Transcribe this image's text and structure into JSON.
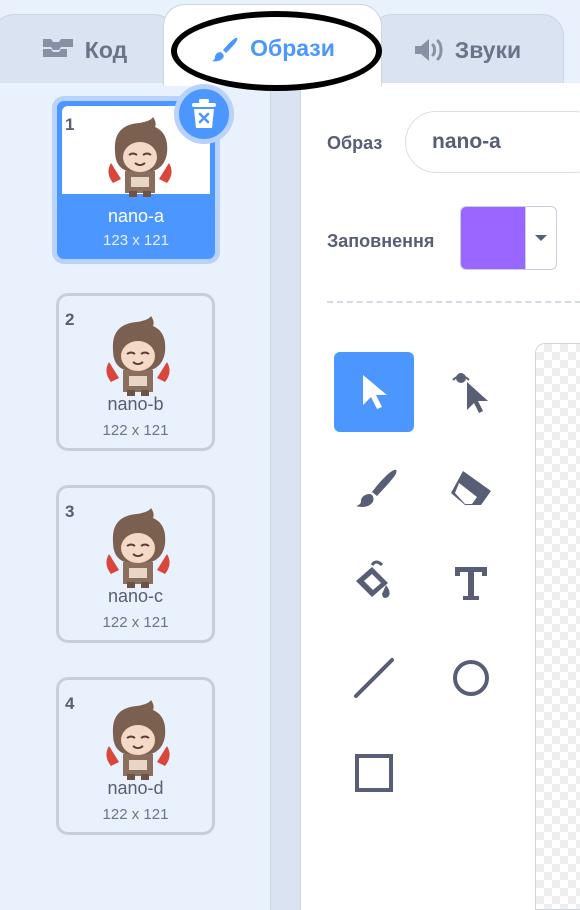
{
  "tabs": {
    "code": {
      "label": "Код",
      "icon": "code-blocks-icon"
    },
    "costumes": {
      "label": "Образи",
      "icon": "paintbrush-icon"
    },
    "sounds": {
      "label": "Звуки",
      "icon": "speaker-icon"
    }
  },
  "costumes": [
    {
      "number": "1",
      "name": "nano-a",
      "size": "123 x 121",
      "selected": true
    },
    {
      "number": "2",
      "name": "nano-b",
      "size": "122 x 121",
      "selected": false
    },
    {
      "number": "3",
      "name": "nano-c",
      "size": "122 x 121",
      "selected": false
    },
    {
      "number": "4",
      "name": "nano-d",
      "size": "122 x 121",
      "selected": false
    }
  ],
  "editor": {
    "costume_label": "Образ",
    "costume_name": "nano-a",
    "fill_label": "Заповнення",
    "fill_color": "#9966ff"
  },
  "colors": {
    "accent": "#4c97ff",
    "text": "#575e75"
  },
  "tools": [
    "select",
    "reshape",
    "brush",
    "eraser",
    "fill",
    "text",
    "line",
    "circle",
    "rectangle"
  ]
}
